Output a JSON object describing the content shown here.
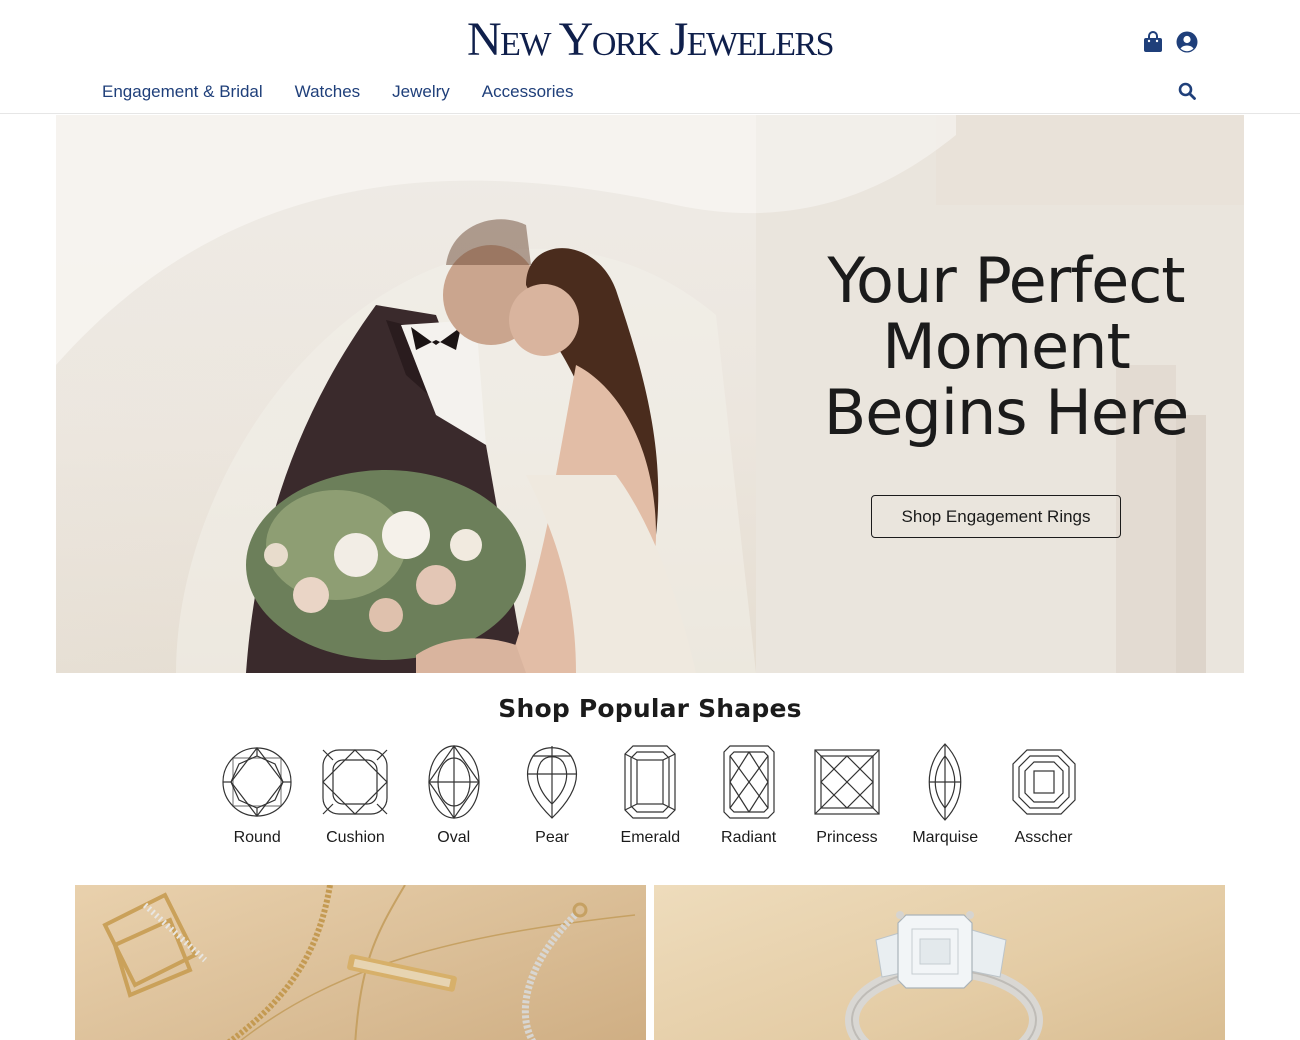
{
  "brand": {
    "name": "New York Jewelers",
    "color": "#0f1f4b"
  },
  "header": {
    "icons": [
      "shopping-bag-icon",
      "user-account-icon"
    ],
    "nav": [
      {
        "label": "Engagement & Bridal"
      },
      {
        "label": "Watches"
      },
      {
        "label": "Jewelry"
      },
      {
        "label": "Accessories"
      }
    ],
    "search_icon": "search-icon",
    "nav_color": "#1f3f7a"
  },
  "hero": {
    "title_line1": "Your Perfect",
    "title_line2": "Moment",
    "title_line3": "Begins Here",
    "button_label": "Shop Engagement Rings"
  },
  "shapes_section": {
    "title": "Shop Popular Shapes",
    "shapes": [
      {
        "label": "Round",
        "icon": "round-diamond-icon"
      },
      {
        "label": "Cushion",
        "icon": "cushion-diamond-icon"
      },
      {
        "label": "Oval",
        "icon": "oval-diamond-icon"
      },
      {
        "label": "Pear",
        "icon": "pear-diamond-icon"
      },
      {
        "label": "Emerald",
        "icon": "emerald-diamond-icon"
      },
      {
        "label": "Radiant",
        "icon": "radiant-diamond-icon"
      },
      {
        "label": "Princess",
        "icon": "princess-diamond-icon"
      },
      {
        "label": "Marquise",
        "icon": "marquise-diamond-icon"
      },
      {
        "label": "Asscher",
        "icon": "asscher-diamond-icon"
      }
    ]
  },
  "promo_tiles": [
    {
      "name": "jewelry-promo-tile"
    },
    {
      "name": "engagement-ring-promo-tile"
    }
  ]
}
